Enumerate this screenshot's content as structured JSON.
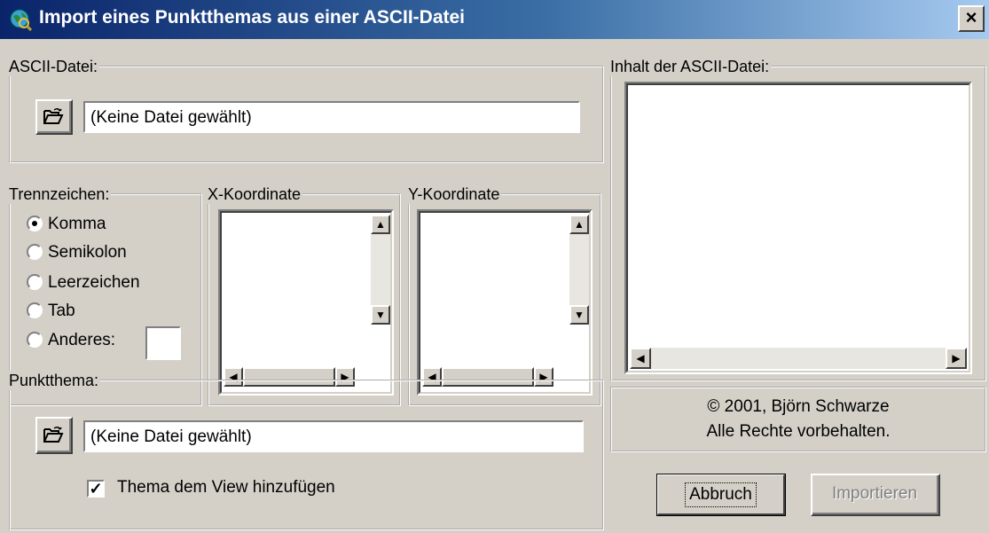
{
  "window": {
    "title": "Import eines Punktthemas aus einer ASCII-Datei",
    "close_glyph": "×"
  },
  "ascii_file": {
    "group_label": "ASCII-Datei:",
    "value": "(Keine Datei gewählt)",
    "browse_icon": "open-folder-icon"
  },
  "separator": {
    "group_label": "Trennzeichen:",
    "options": [
      {
        "label": "Komma",
        "checked": true
      },
      {
        "label": "Semikolon",
        "checked": false
      },
      {
        "label": "Leerzeichen",
        "checked": false
      },
      {
        "label": "Tab",
        "checked": false
      },
      {
        "label": "Anderes:",
        "checked": false
      }
    ],
    "other_value": ""
  },
  "x_coord": {
    "group_label": "X-Koordinate"
  },
  "y_coord": {
    "group_label": "Y-Koordinate"
  },
  "content": {
    "group_label": "Inhalt der ASCII-Datei:"
  },
  "point_theme": {
    "group_label": "Punktthema:",
    "value": "(Keine Datei gewählt)",
    "checkbox_label": "Thema dem View hinzufügen",
    "checkbox_checked": true
  },
  "info": {
    "line1": "© 2001, Björn Schwarze",
    "line2": "Alle Rechte vorbehalten."
  },
  "buttons": {
    "cancel": "Abbruch",
    "import": "Importieren",
    "import_enabled": false
  },
  "colors": {
    "title_gradient_start": "#0a246a",
    "title_gradient_end": "#a6caf0",
    "face": "#d4d0c8"
  }
}
